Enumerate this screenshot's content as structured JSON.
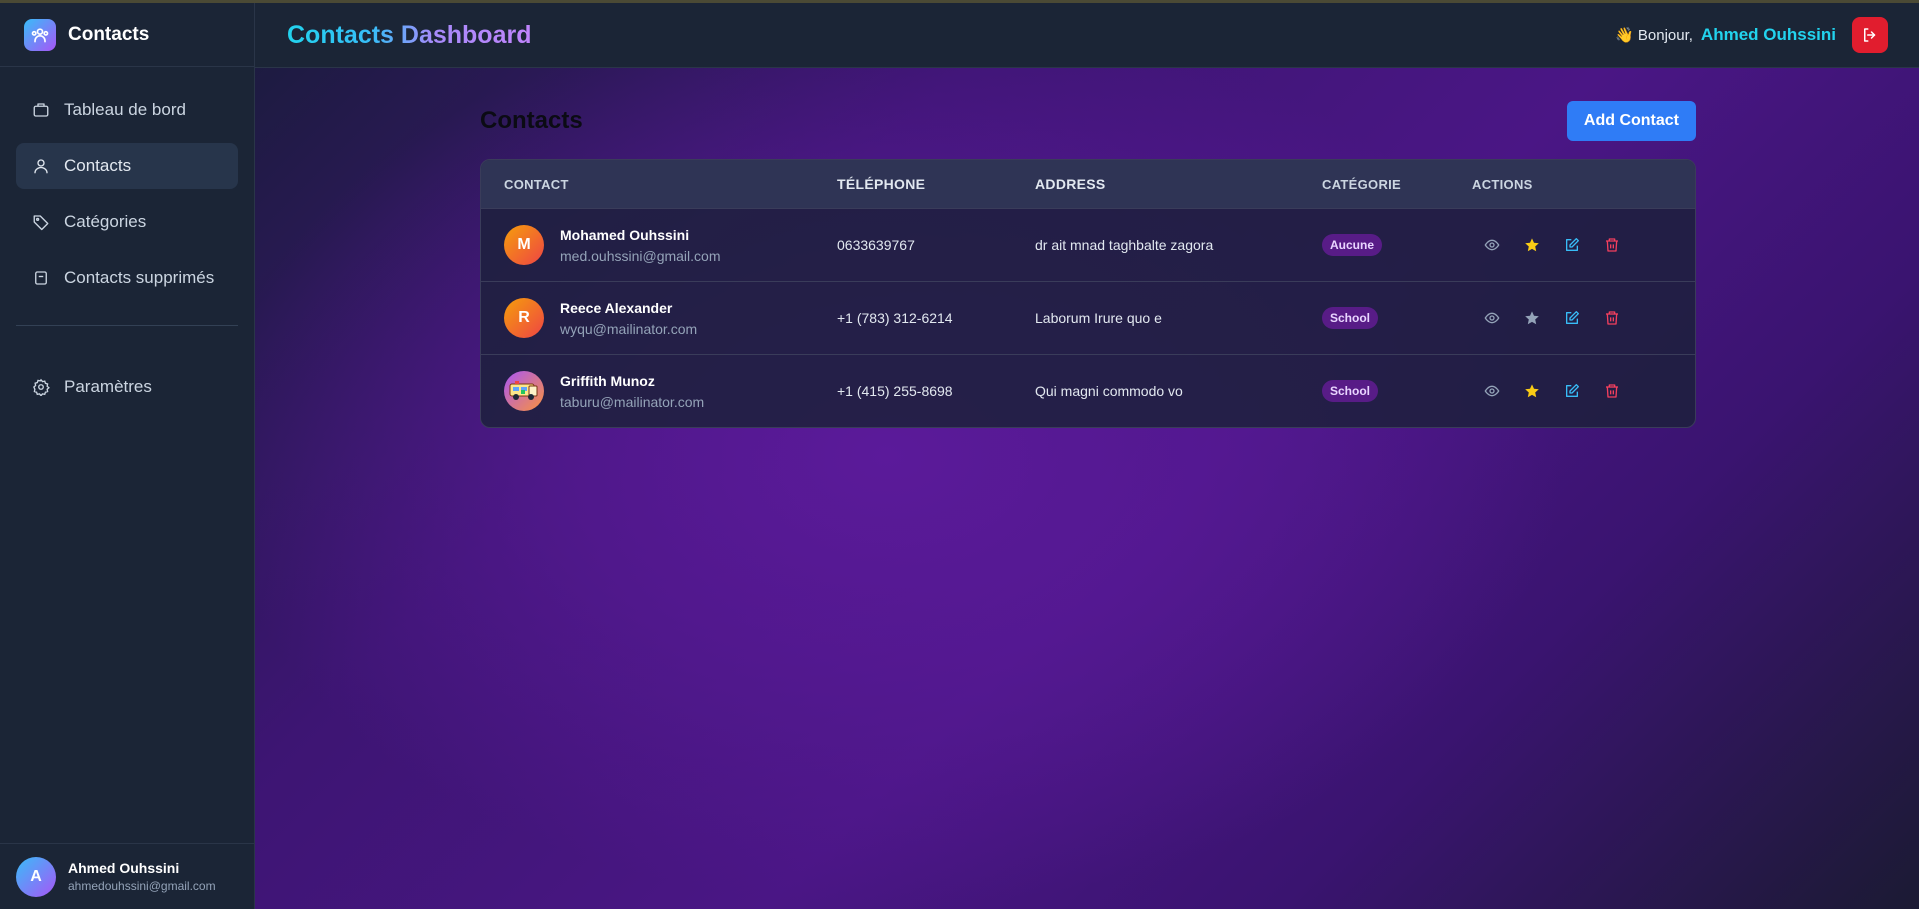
{
  "sidebar": {
    "brand": "Contacts",
    "items": [
      {
        "label": "Tableau de bord",
        "icon": "briefcase-icon"
      },
      {
        "label": "Contacts",
        "icon": "user-icon",
        "active": true
      },
      {
        "label": "Catégories",
        "icon": "tag-icon"
      },
      {
        "label": "Contacts supprimés",
        "icon": "archive-icon"
      }
    ],
    "settings": {
      "label": "Paramètres",
      "icon": "gear-icon"
    },
    "profile": {
      "initial": "A",
      "name": "Ahmed Ouhssini",
      "email": "ahmedouhssini@gmail.com"
    }
  },
  "header": {
    "title": "Contacts Dashboard",
    "greeting": "👋 Bonjour,",
    "user": "Ahmed Ouhssini",
    "logout_icon": "logout-icon"
  },
  "content": {
    "title": "Contacts",
    "add_button": "Add Contact",
    "columns": [
      "Contact",
      "Téléphone",
      "Address",
      "Catégorie",
      "Actions"
    ],
    "rows": [
      {
        "initial": "M",
        "name": "Mohamed Ouhssini",
        "email": "med.ouhssini@gmail.com",
        "phone": "0633639767",
        "address": "dr ait mnad taghbalte zagora",
        "category": "Aucune",
        "favorite": true,
        "avatar": "initial"
      },
      {
        "initial": "R",
        "name": "Reece Alexander",
        "email": "wyqu@mailinator.com",
        "phone": "+1 (783) 312-6214",
        "address": "Laborum Irure quo e",
        "category": "School",
        "favorite": false,
        "avatar": "initial"
      },
      {
        "initial": "",
        "name": "Griffith Munoz",
        "email": "taburu@mailinator.com",
        "phone": "+1 (415) 255-8698",
        "address": "Qui magni commodo vo",
        "category": "School",
        "favorite": true,
        "avatar": "photo"
      }
    ]
  },
  "colors": {
    "accent": "#2f7cf6",
    "cyan": "#22d3ee",
    "danger": "#e11d2e",
    "star_active": "#facc15",
    "star_inactive": "#94a3b8",
    "badge_bg": "#581c87"
  }
}
